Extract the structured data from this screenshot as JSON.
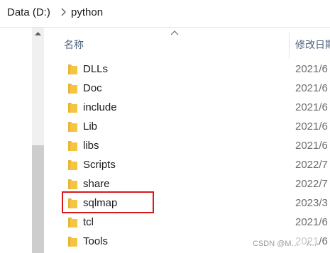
{
  "breadcrumb": {
    "drive": "Data (D:)",
    "folder": "python"
  },
  "columns": {
    "name": "名称",
    "date": "修改日期"
  },
  "rows": [
    {
      "name": "DLLs",
      "date": "2021/6"
    },
    {
      "name": "Doc",
      "date": "2021/6"
    },
    {
      "name": "include",
      "date": "2021/6"
    },
    {
      "name": "Lib",
      "date": "2021/6"
    },
    {
      "name": "libs",
      "date": "2021/6"
    },
    {
      "name": "Scripts",
      "date": "2022/7"
    },
    {
      "name": "share",
      "date": "2022/7"
    },
    {
      "name": "sqlmap",
      "date": "2023/3"
    },
    {
      "name": "tcl",
      "date": "2021/6"
    },
    {
      "name": "Tools",
      "date": "2021/6"
    }
  ],
  "highlighted_item": "sqlmap",
  "watermark": "CSDN @M…　/…",
  "colors": {
    "highlight": "#d9181c",
    "folder": "#f5c542",
    "header_text": "#4c607a"
  },
  "icons": {
    "folder": "folder-icon",
    "separator": "chevron-right-icon",
    "sort": "sort-up-icon"
  }
}
